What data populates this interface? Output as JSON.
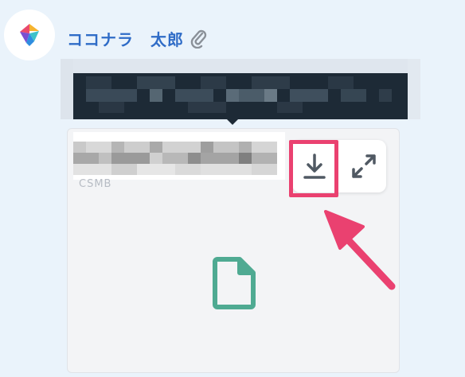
{
  "message": {
    "sender_name": "ココナラ　太郎",
    "attachment_icon": "paperclip-icon",
    "avatar_icon": "coconala-logo-icon"
  },
  "attachment": {
    "extension_hint": "CSMB",
    "file_type_icon": "document-file-icon",
    "actions": {
      "download_icon": "download-icon",
      "expand_icon": "expand-icon"
    }
  },
  "colors": {
    "background": "#eaf3fb",
    "name": "#2f6cc7",
    "tooltip": "#1d2a36",
    "highlight": "#ea4170",
    "file_icon": "#4faa92",
    "icon_gray": "#505963"
  }
}
